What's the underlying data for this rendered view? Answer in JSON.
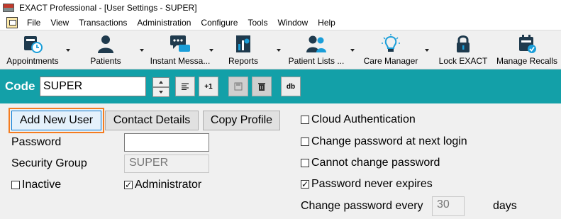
{
  "window": {
    "title": "EXACT Professional - [User Settings - SUPER]"
  },
  "menu": [
    "File",
    "View",
    "Transactions",
    "Administration",
    "Configure",
    "Tools",
    "Window",
    "Help"
  ],
  "toolbar": {
    "appointments": "Appointments",
    "patients": "Patients",
    "instant_messages": "Instant Messa...",
    "reports": "Reports",
    "patient_lists": "Patient Lists ...",
    "care_manager": "Care Manager",
    "lock_exact": "Lock EXACT",
    "manage_recalls": "Manage Recalls"
  },
  "code_bar": {
    "label": "Code",
    "value": "SUPER",
    "plus_one": "+1",
    "db": "db"
  },
  "buttons": {
    "add_new_user": "Add New User",
    "contact_details": "Contact Details",
    "copy_profile": "Copy Profile"
  },
  "fields": {
    "password_label": "Password",
    "password_value": "",
    "security_group_label": "Security Group",
    "security_group_value": "SUPER"
  },
  "checkboxes": {
    "inactive": {
      "label": "Inactive",
      "checked": false
    },
    "administrator": {
      "label": "Administrator",
      "checked": true
    },
    "cloud_auth": {
      "label": "Cloud Authentication",
      "checked": false
    },
    "change_pw_next_login": {
      "label": "Change password at next login",
      "checked": false
    },
    "cannot_change_pw": {
      "label": "Cannot change password",
      "checked": false
    },
    "pw_never_expires": {
      "label": "Password never expires",
      "checked": true
    }
  },
  "expiry": {
    "label": "Change password every",
    "value": "30",
    "unit": "days"
  },
  "colors": {
    "accent": "#13a0a8",
    "focus": "#f47c20"
  }
}
